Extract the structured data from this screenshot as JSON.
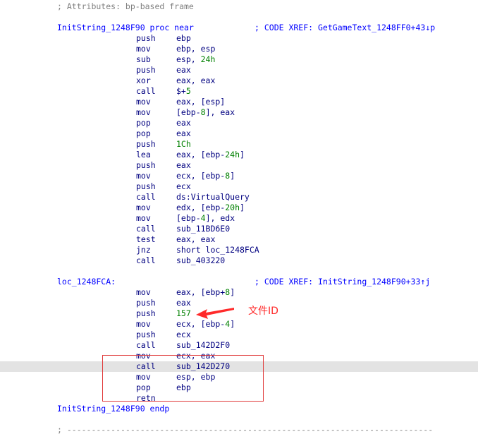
{
  "header_comment": "; Attributes: bp-based frame",
  "proc_start": {
    "label": "InitString_1248F90 proc near",
    "comment": "; CODE XREF: GetGameText_1248FF0+43↓p"
  },
  "block1": [
    {
      "mn": "push",
      "op": "ebp"
    },
    {
      "mn": "mov",
      "op": "ebp, esp"
    },
    {
      "mn": "sub",
      "op": "esp, 24h"
    },
    {
      "mn": "push",
      "op": "eax"
    },
    {
      "mn": "xor",
      "op": "eax, eax"
    },
    {
      "mn": "call",
      "op": "$+5"
    },
    {
      "mn": "mov",
      "op": "eax, [esp]"
    },
    {
      "mn": "mov",
      "op": "[ebp-8], eax"
    },
    {
      "mn": "pop",
      "op": "eax"
    },
    {
      "mn": "pop",
      "op": "eax"
    },
    {
      "mn": "push",
      "op": "1Ch"
    },
    {
      "mn": "lea",
      "op": "eax, [ebp-24h]"
    },
    {
      "mn": "push",
      "op": "eax"
    },
    {
      "mn": "mov",
      "op": "ecx, [ebp-8]"
    },
    {
      "mn": "push",
      "op": "ecx"
    },
    {
      "mn": "call",
      "op": "ds:VirtualQuery"
    },
    {
      "mn": "mov",
      "op": "edx, [ebp-20h]"
    },
    {
      "mn": "mov",
      "op": "[ebp-4], edx"
    },
    {
      "mn": "call",
      "op": "sub_11BD6E0"
    },
    {
      "mn": "test",
      "op": "eax, eax"
    },
    {
      "mn": "jnz",
      "op": "short loc_1248FCA"
    },
    {
      "mn": "call",
      "op": "sub_403220"
    }
  ],
  "loc_label": {
    "label": "loc_1248FCA:",
    "comment": "; CODE XREF: InitString_1248F90+33↑j"
  },
  "block2": [
    {
      "mn": "mov",
      "op": "eax, [ebp+8]"
    },
    {
      "mn": "push",
      "op": "eax"
    },
    {
      "mn": "push",
      "op": "157"
    },
    {
      "mn": "mov",
      "op": "ecx, [ebp-4]"
    },
    {
      "mn": "push",
      "op": "ecx"
    },
    {
      "mn": "call",
      "op": "sub_142D2F0"
    },
    {
      "mn": "mov",
      "op": "ecx, eax"
    },
    {
      "mn": "call",
      "op": "sub_142D270"
    },
    {
      "mn": "mov",
      "op": "esp, ebp"
    },
    {
      "mn": "pop",
      "op": "ebp"
    },
    {
      "mn": "retn",
      "op": ""
    }
  ],
  "proc_end": "InitString_1248F90 endp",
  "footer_separator": "; ---------------------------------------------------------------------------",
  "annotation": {
    "text": "文件ID"
  },
  "colors": {
    "label": "#0000ff",
    "instruction": "#000080",
    "number": "#008000",
    "comment": "#808080",
    "annotation": "#ff2a2a"
  }
}
